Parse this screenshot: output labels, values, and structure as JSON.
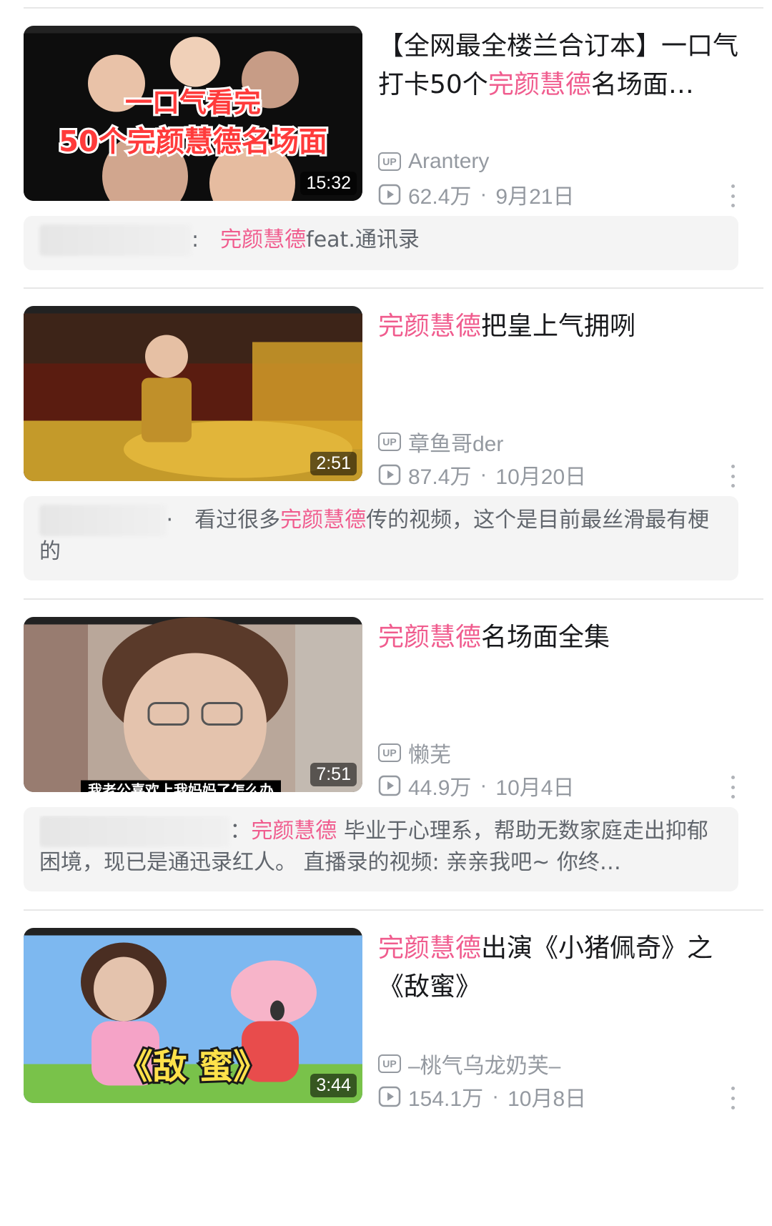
{
  "videos": [
    {
      "title_prefix": "【全网最全楼兰合订本】一口气打卡50个",
      "title_highlight": "完颜慧德",
      "title_suffix": "名场面…",
      "duration": "15:32",
      "thumb_text_1": "一口气看完",
      "thumb_text_2": "50个完颜慧德名场面",
      "uploader": "Arantery",
      "views": "62.4万",
      "date": "9月21日",
      "comment": {
        "author": "",
        "text_prefix": "",
        "text_highlight": "完颜慧德",
        "text_suffix": "feat.通讯录"
      }
    },
    {
      "title_prefix": "",
      "title_highlight": "完颜慧德",
      "title_suffix": "把皇上气拥咧",
      "duration": "2:51",
      "uploader": "章鱼哥der",
      "views": "87.4万",
      "date": "10月20日",
      "comment": {
        "author": "",
        "text_prefix": "看过很多",
        "text_highlight": "完颜慧德",
        "text_suffix": "传的视频，这个是目前最丝滑最有梗的"
      }
    },
    {
      "title_prefix": "",
      "title_highlight": "完颜慧德",
      "title_suffix": "名场面全集",
      "duration": "7:51",
      "thumb_caption": "我老公喜欢上我妈妈了怎么办",
      "uploader": "懒芜",
      "views": "44.9万",
      "date": "10月4日",
      "comment": {
        "author": "",
        "text_prefix": "",
        "text_highlight": "完颜慧德",
        "text_suffix": " 毕业于心理系，帮助无数家庭走出抑郁困境，现已是通迅录红人。 直播录的视频: 亲亲我吧~ 你终…"
      }
    },
    {
      "title_prefix": "",
      "title_highlight": "完颜慧德",
      "title_suffix": "出演《小猪佩奇》之《敌蜜》",
      "duration": "3:44",
      "thumb_caption": "《敌 蜜》",
      "uploader": "–桃气乌龙奶芙–",
      "views": "154.1万",
      "date": "10月8日"
    }
  ],
  "icons": {
    "up": "UP",
    "play": "play-icon",
    "more": "more-icon"
  },
  "colors": {
    "highlight": "#f05c8e",
    "meta": "#9499a0"
  }
}
